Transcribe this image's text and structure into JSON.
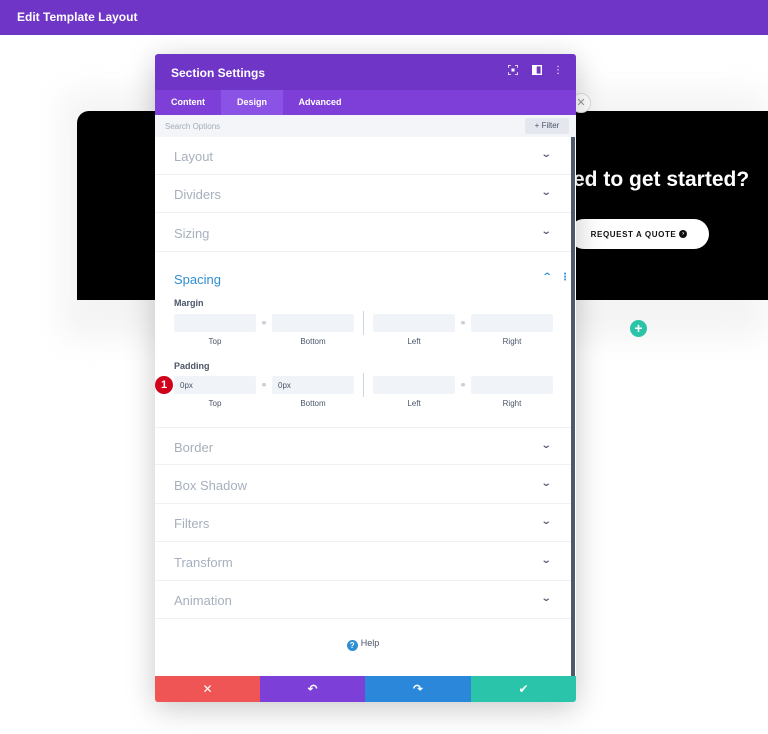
{
  "topbar": {
    "title": "Edit Template Layout"
  },
  "hero": {
    "heading": "ed to get started?",
    "button_label": "REQUEST A QUOTE"
  },
  "modal": {
    "title": "Section Settings",
    "tabs": [
      {
        "label": "Content",
        "active": false
      },
      {
        "label": "Design",
        "active": true
      },
      {
        "label": "Advanced",
        "active": false
      }
    ],
    "search": {
      "placeholder": "Search Options",
      "filter_label": "Filter"
    },
    "sections_top": [
      "Layout",
      "Dividers",
      "Sizing"
    ],
    "spacing": {
      "title": "Spacing",
      "margin": {
        "label": "Margin",
        "fields": [
          {
            "caption": "Top",
            "value": ""
          },
          {
            "caption": "Bottom",
            "value": ""
          },
          {
            "caption": "Left",
            "value": ""
          },
          {
            "caption": "Right",
            "value": ""
          }
        ]
      },
      "padding": {
        "label": "Padding",
        "fields": [
          {
            "caption": "Top",
            "value": "0px"
          },
          {
            "caption": "Bottom",
            "value": "0px"
          },
          {
            "caption": "Left",
            "value": ""
          },
          {
            "caption": "Right",
            "value": ""
          }
        ]
      }
    },
    "sections_bottom": [
      "Border",
      "Box Shadow",
      "Filters",
      "Transform",
      "Animation"
    ],
    "help_label": "Help",
    "step_badge": "1"
  },
  "colors": {
    "accent_purple": "#6f35c7",
    "cancel": "#ef5555",
    "undo": "#7c3fd8",
    "redo": "#2b87da",
    "save": "#29c4a9"
  }
}
